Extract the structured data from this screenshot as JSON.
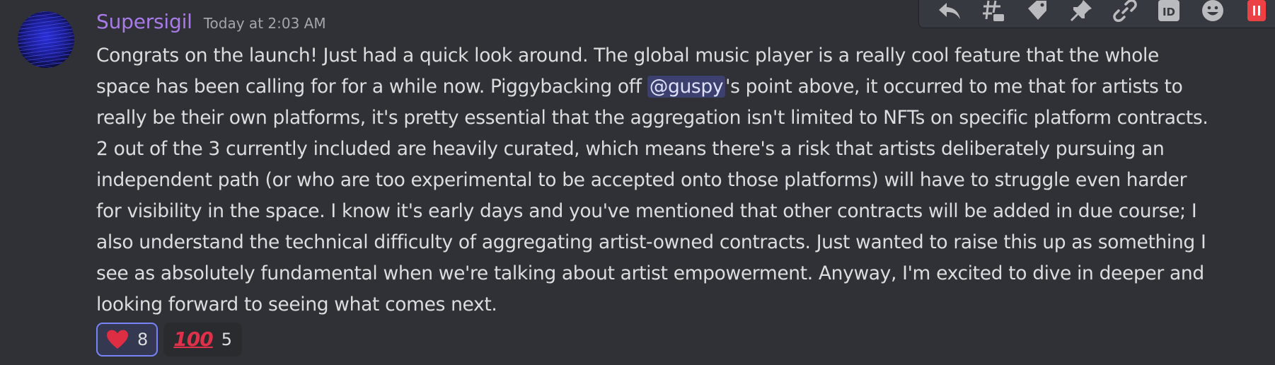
{
  "message": {
    "username": "Supersigil",
    "timestamp": "Today at 2:03 AM",
    "mention": "@guspy",
    "lines": [
      "Congrats on the launch! Just had a quick look around. The global music player is a really cool feature that the whole",
      "space has been calling for for a while now. Piggybacking off ",
      "'s point above, it occurred to me that for artists to",
      "really be their own platforms, it's pretty essential that the aggregation isn't limited to NFTs on specific platform contracts.",
      "2 out of the 3 currently included are heavily curated, which means there's a risk that artists deliberately pursuing an",
      "independent path (or who are too experimental to be accepted onto those platforms) will have to struggle even harder",
      "for visibility in the space. I know it's early days and you've mentioned that other contracts will be added in due course; I",
      "also understand the technical difficulty of aggregating artist-owned contracts. Just wanted to raise this up as something I",
      "see as absolutely fundamental when we're talking about artist empowerment. Anyway, I'm excited to dive in deeper and",
      "looking forward to seeing what comes next."
    ]
  },
  "reactions": [
    {
      "emoji": "heart",
      "count": "8",
      "active": true
    },
    {
      "emoji": "100",
      "emoji_text": "100",
      "count": "5",
      "active": false
    }
  ],
  "toolbar": {
    "icons": [
      "reply-icon",
      "thread-icon",
      "tag-icon",
      "pin-icon",
      "link-icon",
      "id-icon",
      "add-reaction-icon",
      "delete-icon"
    ]
  },
  "colors": {
    "background": "#2f3136",
    "username": "#a97be8",
    "text": "#dcddde",
    "mention_bg": "rgba(88,101,242,0.3)",
    "reaction_active_border": "#7983f5",
    "danger": "#ed4245"
  }
}
